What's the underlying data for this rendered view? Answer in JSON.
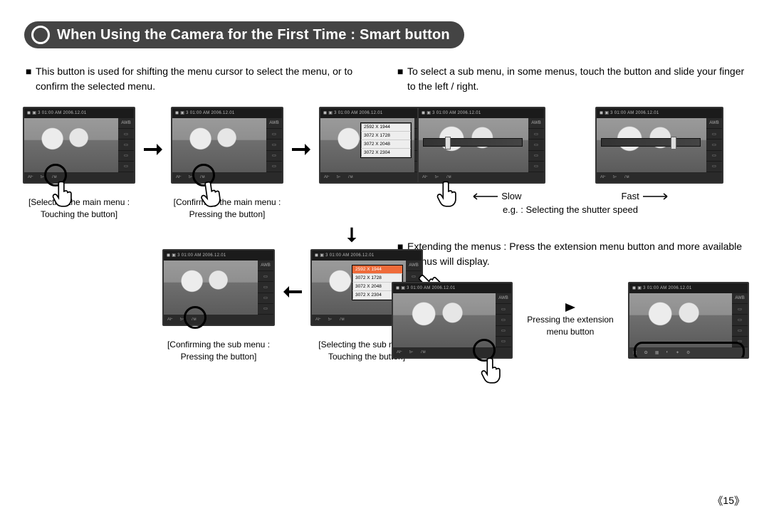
{
  "title": "When Using the Camera for the First Time : Smart button",
  "left": {
    "intro": "This button is used for shifting the menu cursor to select the menu, or to confirm the selected menu.",
    "captions": {
      "sel_main": "[Selecting the main menu : Touching the button]",
      "conf_main": "[Confirming the main menu : Pressing the button]",
      "sel_sub": "[Selecting the sub menu : Touching the button]",
      "conf_sub": "[Confirming the sub menu : Pressing the button]"
    }
  },
  "right": {
    "intro_slide": "To select a sub menu, in some menus, touch the button and slide your finger to the left / right.",
    "slow": "Slow",
    "fast": "Fast",
    "eg": "e.g. : Selecting the shutter speed",
    "intro_ext": "Extending the menus : Press the extension menu button and more available menus will display.",
    "ext_caption": "Pressing the extension menu button"
  },
  "lcd": {
    "topbar": "◼ ▣ 3     01:00 AM 2006.12.01",
    "right_items": [
      "AWB",
      "▭",
      "▭",
      "▭",
      "▭"
    ],
    "bottom": {
      "af": "AF",
      "iso": "5▫",
      "size": "7м"
    },
    "menu_items": [
      "2592 X 1944",
      "3072 X 1728",
      "3072 X 2048",
      "3072 X 2304"
    ]
  },
  "page_number": "15"
}
